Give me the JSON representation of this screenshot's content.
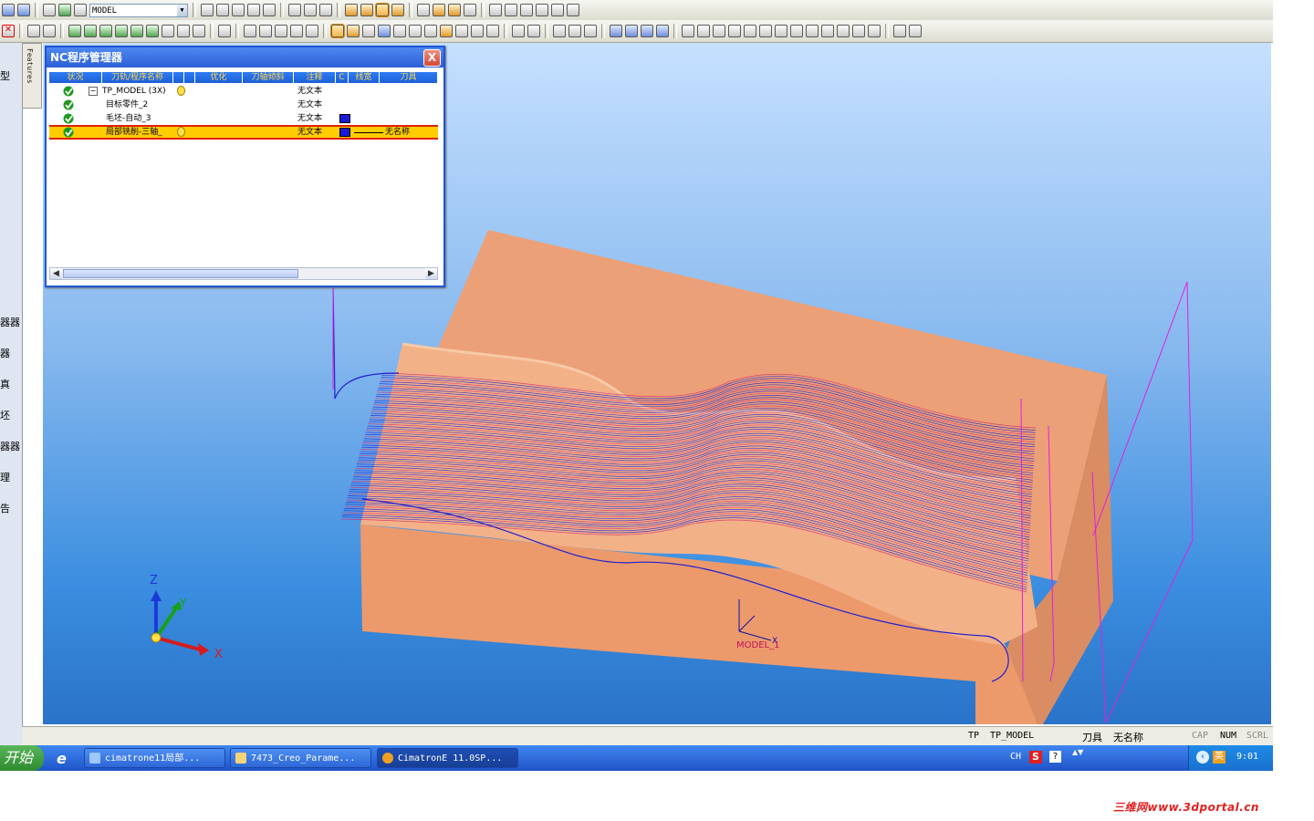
{
  "toolbar": {
    "model_combo_value": "MODEL"
  },
  "left_panel": {
    "labels": [
      "型",
      "器器",
      "器",
      "真",
      "坯",
      "器器",
      "理",
      "告"
    ],
    "features_tab": "Features"
  },
  "nc_manager": {
    "title": "NC程序管理器",
    "close": "X",
    "columns": [
      "状况",
      "刀轨/程序名称",
      "",
      "",
      "优化",
      "刀轴倾斜",
      "注释",
      "C",
      "线宽",
      "刀具"
    ],
    "rows": [
      {
        "name": "TP_MODEL (3X)",
        "note": "无文本",
        "tool": "",
        "selected": false,
        "expand": "−"
      },
      {
        "name": "目标零件_2",
        "note": "无文本",
        "tool": "",
        "selected": false
      },
      {
        "name": "毛坯-自动_3",
        "note": "无文本",
        "tool": "",
        "selected": false
      },
      {
        "name": "局部铣削-三轴_",
        "note": "无文本",
        "tool": "无名称",
        "selected": true
      }
    ]
  },
  "viewport": {
    "axis_labels": {
      "z": "Z",
      "y": "Y",
      "x": "X"
    },
    "model_label": "MODEL_1",
    "model_axis_x": "X"
  },
  "status": {
    "tp_label": "TP",
    "tp_value": "TP_MODEL",
    "tool_label": "刀具",
    "tool_value": "无名称",
    "cap": "CAP",
    "num": "NUM",
    "scrl": "SCRL"
  },
  "taskbar": {
    "start": "开始",
    "tasks": [
      "cimatrone11局部...",
      "7473_Creo_Parame...",
      "CimatronE 11.0SP..."
    ],
    "lang": "CH",
    "clock": "9:01"
  },
  "watermark": "三维网www.3dportal.cn",
  "colors": {
    "viewport_top": "#c6e0ff",
    "viewport_bottom": "#2a73c8",
    "block": "#e8966a",
    "toolpath": "#2020d0",
    "nc_title": "#2a5fd6",
    "selected_row": "#ffcc00"
  }
}
